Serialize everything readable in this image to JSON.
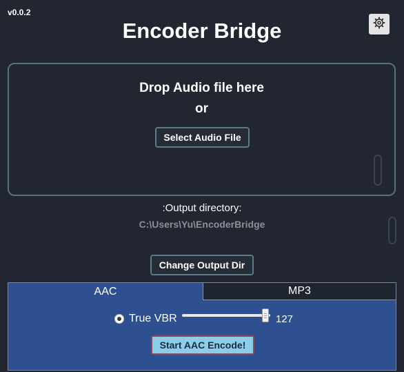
{
  "app": {
    "version": "v0.0.2",
    "title": "Encoder Bridge"
  },
  "settings": {
    "icon": "gear-icon"
  },
  "dropzone": {
    "line1": "Drop Audio file here",
    "line2": "or",
    "select_button": "Select Audio File"
  },
  "output": {
    "label": ":Output directory:",
    "path": "C:\\Users\\Yu\\EncoderBridge",
    "change_button": "Change Output Dir"
  },
  "tabs": [
    {
      "label": "AAC",
      "active": true
    },
    {
      "label": "MP3",
      "active": false
    }
  ],
  "aac": {
    "mode_label": "True VBR",
    "mode_selected": true,
    "quality_value": "127",
    "quality_max": 127,
    "start_button": "Start AAC Encode!"
  },
  "colors": {
    "background": "#212630",
    "panel": "#2f5090",
    "start_button": "#8dcdea"
  }
}
